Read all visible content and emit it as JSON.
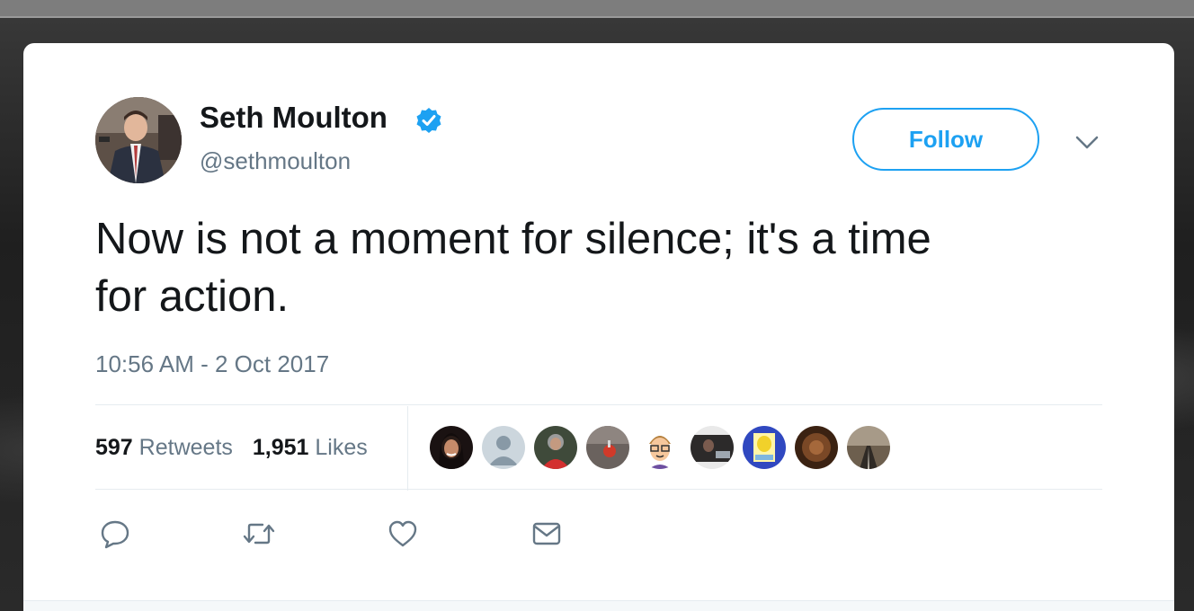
{
  "tweet": {
    "author": {
      "display_name": "Seth Moulton",
      "handle": "@sethmoulton",
      "verified": true,
      "avatar_icon": "profile-photo"
    },
    "follow_label": "Follow",
    "text": "Now is not a moment for silence; it's a time\nfor action.",
    "timestamp": "10:56 AM - 2 Oct 2017",
    "stats": {
      "retweets_count": "597",
      "retweets_label": "Retweets",
      "likes_count": "1,951",
      "likes_label": "Likes"
    },
    "likers": [
      {
        "icon": "liker-avatar-1",
        "color": "#2a1a1a"
      },
      {
        "icon": "liker-avatar-default",
        "color": "#aab8c2"
      },
      {
        "icon": "liker-avatar-3",
        "color": "#c0392b"
      },
      {
        "icon": "liker-avatar-4",
        "color": "#7a6f6a"
      },
      {
        "icon": "liker-avatar-bitmoji",
        "color": "#f4c48a"
      },
      {
        "icon": "liker-avatar-6",
        "color": "#3b3b3b"
      },
      {
        "icon": "liker-avatar-simpsons",
        "color": "#3b4fc4"
      },
      {
        "icon": "liker-avatar-8",
        "color": "#6b3a1f"
      },
      {
        "icon": "liker-avatar-road",
        "color": "#8a7a63"
      }
    ],
    "actions": [
      "reply-icon",
      "retweet-icon",
      "like-icon",
      "direct-message-icon"
    ]
  },
  "colors": {
    "accent": "#1da1f2",
    "text_primary": "#14171a",
    "text_secondary": "#657786"
  }
}
